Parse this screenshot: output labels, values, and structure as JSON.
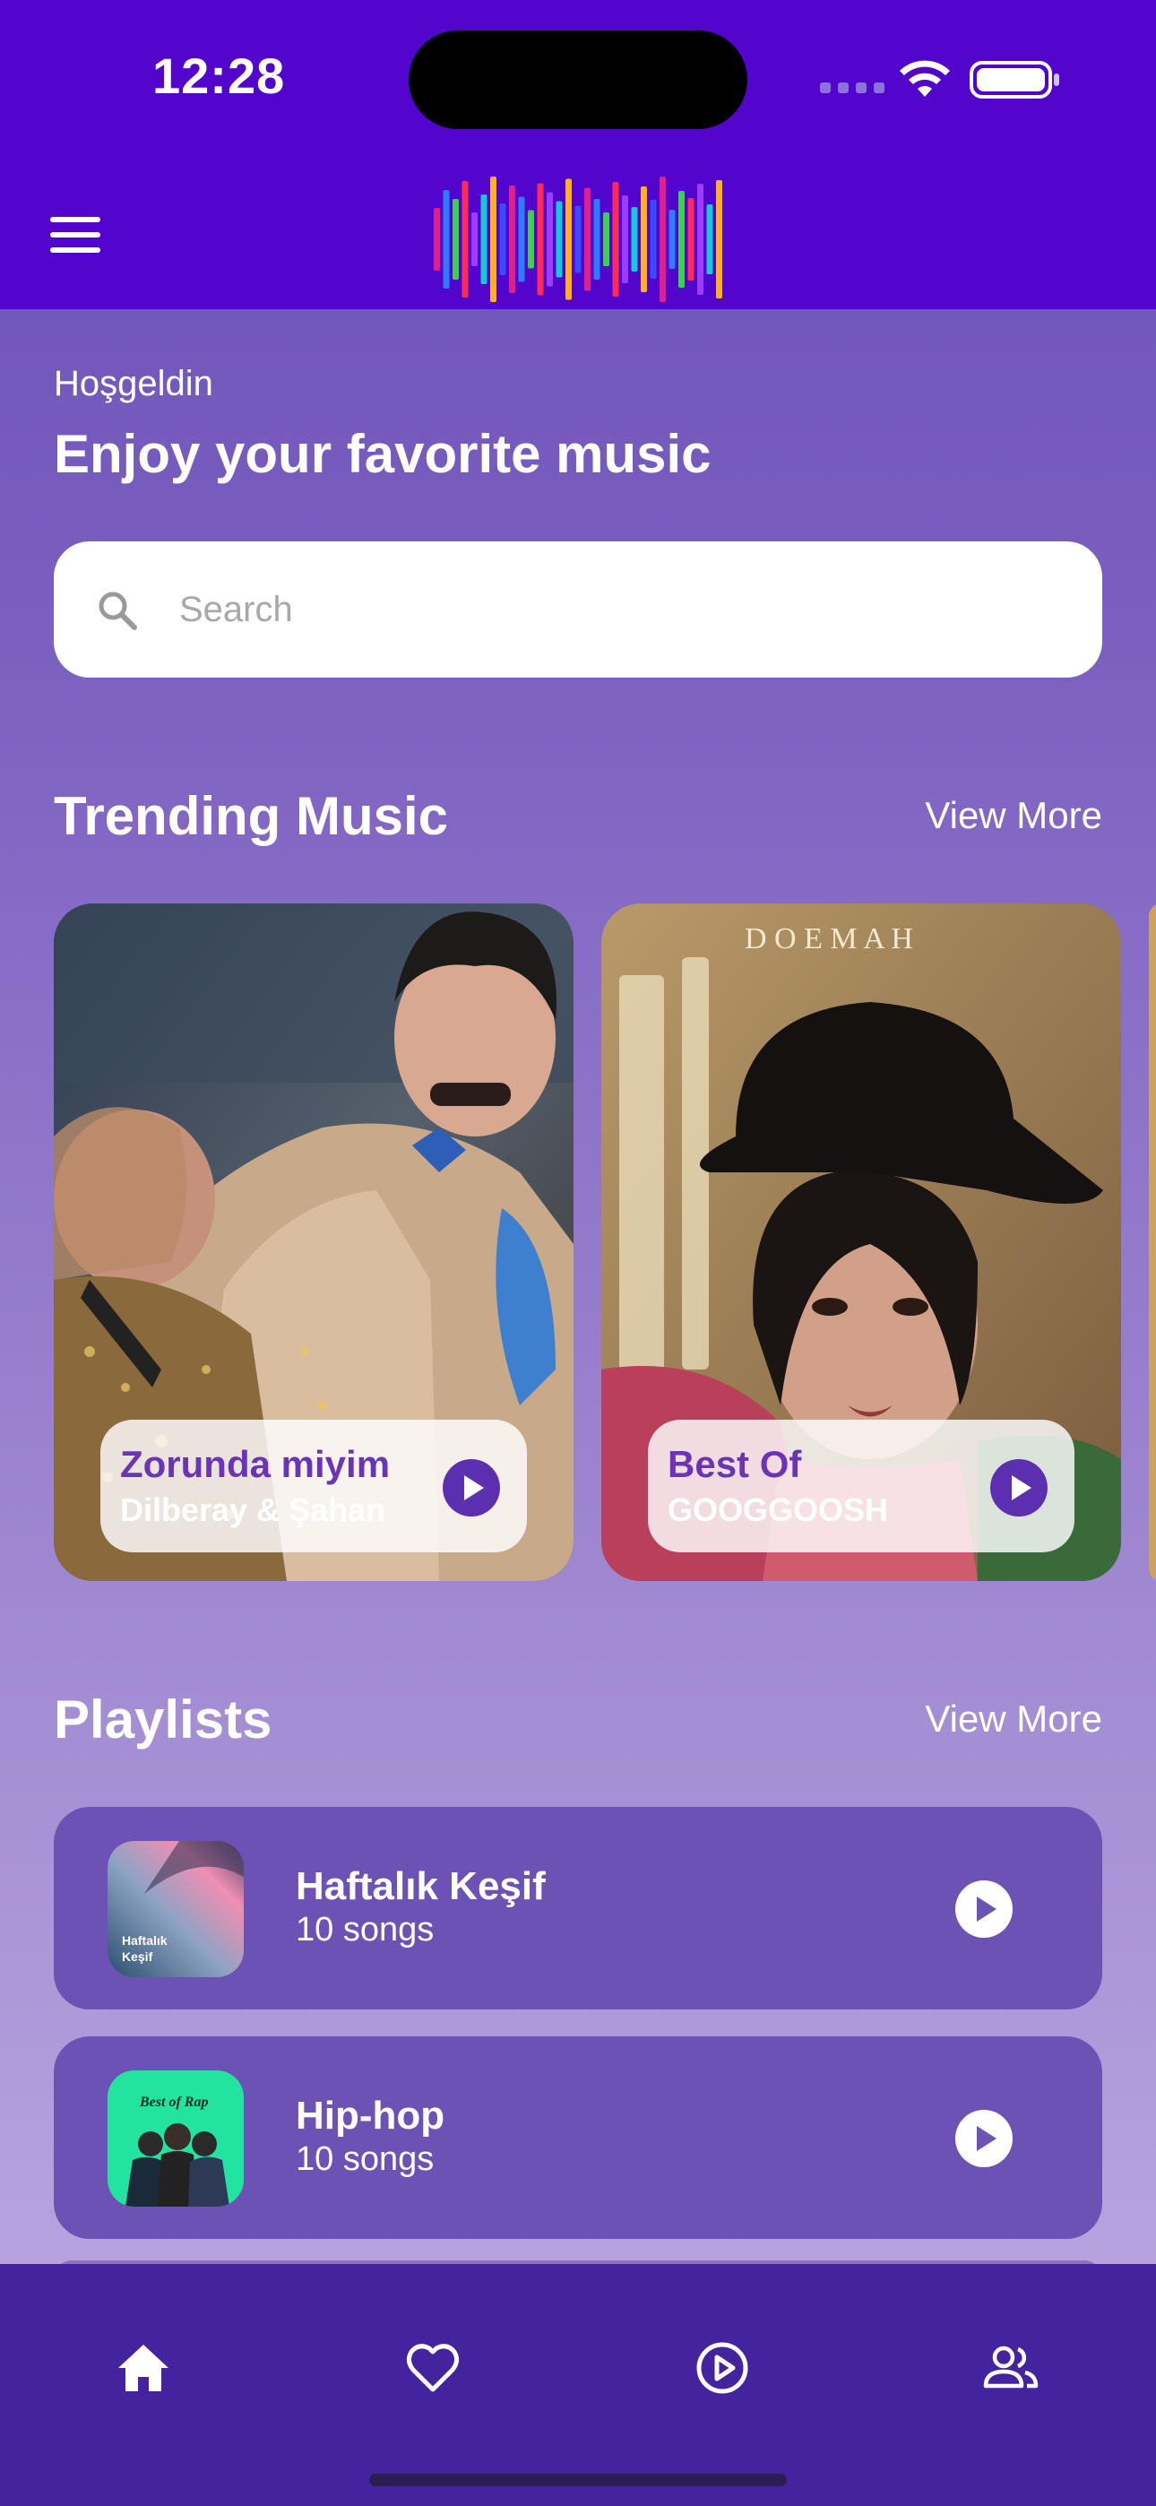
{
  "status_bar": {
    "time": "12:28"
  },
  "header": {
    "menu_icon": "hamburger-menu-icon",
    "logo": "equalizer-logo"
  },
  "welcome": {
    "greeting": "Hoşgeldin",
    "headline": "Enjoy your favorite music"
  },
  "search": {
    "placeholder": "Search",
    "value": "",
    "icon": "search-icon"
  },
  "trending": {
    "title": "Trending Music",
    "view_more": "View More",
    "items": [
      {
        "title": "Zorunda miyim",
        "artist": "Dilberay & Şahan"
      },
      {
        "title": "Best Of",
        "artist": "GOOGGOOSH"
      }
    ]
  },
  "playlists": {
    "title": "Playlists",
    "view_more": "View More",
    "items": [
      {
        "name": "Haftalık Keşif",
        "count": "10 songs",
        "cover_text": "Haftalık Keşif",
        "cover_line1": "Haftalık",
        "cover_line2": "Keşif"
      },
      {
        "name": "Hip-hop",
        "count": "10 songs",
        "cover_text": "Best of Rap"
      }
    ]
  },
  "bottom_nav": [
    {
      "icon": "home-icon",
      "active": true
    },
    {
      "icon": "heart-icon",
      "active": false
    },
    {
      "icon": "play-circle-icon",
      "active": false
    },
    {
      "icon": "people-icon",
      "active": false
    }
  ],
  "colors": {
    "header_bg": "#5205cc",
    "body_top": "#6b50b8",
    "body_bottom": "#b6a3de",
    "card_title": "#6a34b8",
    "playlist_bg": "#6c52b4",
    "nav_bg": "#44249e"
  }
}
